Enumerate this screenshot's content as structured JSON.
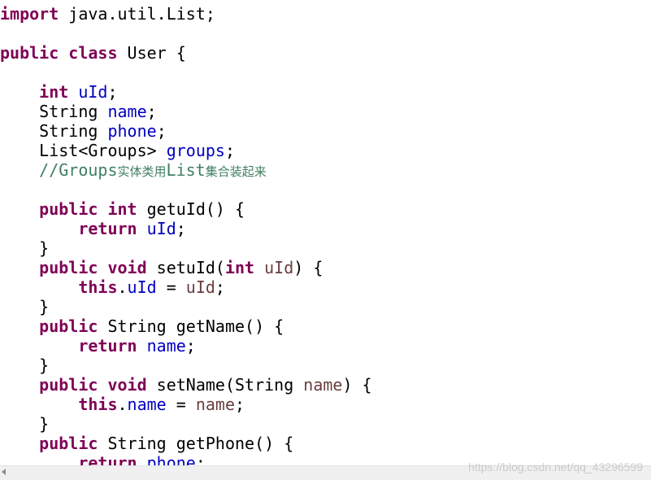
{
  "code": {
    "line1": {
      "kw": "import",
      "rest": " java.util.List;"
    },
    "line3": {
      "kw1": "public",
      "kw2": "class",
      "rest": " User {"
    },
    "line5": {
      "indent": "    ",
      "kw": "int",
      "field": "uId",
      "rest": ";"
    },
    "line6": {
      "indent": "    ",
      "type": "String ",
      "field": "name",
      "rest": ";"
    },
    "line7": {
      "indent": "    ",
      "type": "String ",
      "field": "phone",
      "rest": ";"
    },
    "line8": {
      "indent": "    ",
      "type": "List<Groups> ",
      "field": "groups",
      "rest": ";"
    },
    "line9": {
      "indent": "    ",
      "comment_prefix": "//Groups",
      "comment_cjk1": "实体类用",
      "comment_mid": "List",
      "comment_cjk2": "集合装起来"
    },
    "line11": {
      "indent": "    ",
      "kw1": "public",
      "kw2": "int",
      "rest": " getuId() {"
    },
    "line12": {
      "indent": "        ",
      "kw": "return",
      "field": "uId",
      "rest": ";"
    },
    "line13": {
      "indent": "    ",
      "rest": "}"
    },
    "line14": {
      "indent": "    ",
      "kw1": "public",
      "kw2": "void",
      "mid": " setuId(",
      "kw3": "int",
      "param": "uId",
      "rest": ") {"
    },
    "line15": {
      "indent": "        ",
      "kw": "this",
      "dot": ".",
      "field": "uId",
      "eq": " = ",
      "param": "uId",
      "rest": ";"
    },
    "line16": {
      "indent": "    ",
      "rest": "}"
    },
    "line17": {
      "indent": "    ",
      "kw": "public",
      "rest": " String getName() {"
    },
    "line18": {
      "indent": "        ",
      "kw": "return",
      "field": "name",
      "rest": ";"
    },
    "line19": {
      "indent": "    ",
      "rest": "}"
    },
    "line20": {
      "indent": "    ",
      "kw1": "public",
      "kw2": "void",
      "mid": " setName(String ",
      "param": "name",
      "rest": ") {"
    },
    "line21": {
      "indent": "        ",
      "kw": "this",
      "dot": ".",
      "field": "name",
      "eq": " = ",
      "param": "name",
      "rest": ";"
    },
    "line22": {
      "indent": "    ",
      "rest": "}"
    },
    "line23": {
      "indent": "    ",
      "kw": "public",
      "rest": " String getPhone() {"
    },
    "line24": {
      "indent": "        ",
      "kw": "return",
      "field": "phone",
      "rest": ";"
    }
  },
  "watermark": "https://blog.csdn.net/qq_43296599",
  "colors": {
    "keyword": "#7f0055",
    "field": "#0000c0",
    "parameter": "#6a3e3e",
    "comment": "#3f7f5f"
  },
  "icons": {
    "scroll_left": "scroll-left-arrow-icon"
  }
}
